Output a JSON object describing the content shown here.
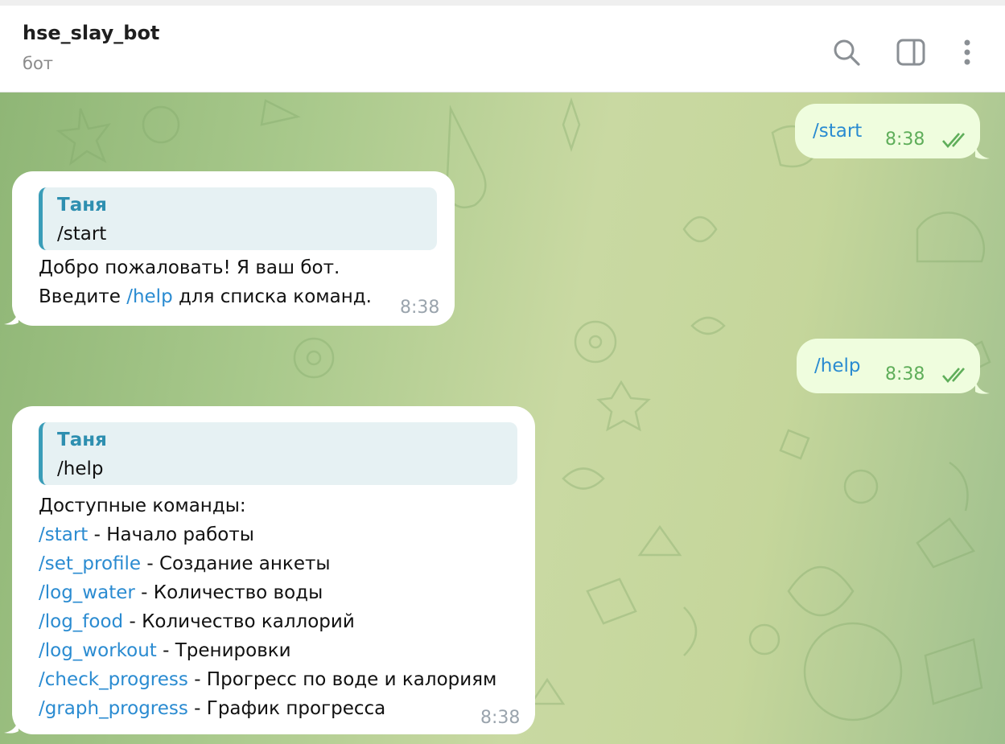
{
  "header": {
    "title": "hse_slay_bot",
    "subtitle": "бот",
    "icons": [
      "search-icon",
      "sidebar-toggle-icon",
      "more-vertical-icon"
    ]
  },
  "colors": {
    "outgoing_bubble": "#effdde",
    "incoming_bubble": "#ffffff",
    "command_link": "#2a8bd1",
    "quote_accent": "#3a9db8",
    "time_outgoing": "#5fae5a"
  },
  "messages": [
    {
      "type": "outgoing",
      "text": "/start",
      "time": "8:38",
      "status_icon": "double-check-icon"
    },
    {
      "type": "incoming",
      "reply_to": {
        "author": "Таня",
        "text": "/start"
      },
      "line1": "Добро пожаловать! Я ваш бот.",
      "line2_prefix": "Введите ",
      "line2_cmd": "/help",
      "line2_suffix": " для списка команд.",
      "time": "8:38"
    },
    {
      "type": "outgoing",
      "text": "/help",
      "time": "8:38",
      "status_icon": "double-check-icon"
    },
    {
      "type": "incoming",
      "reply_to": {
        "author": "Таня",
        "text": "/help"
      },
      "heading": "Доступные команды:",
      "commands": [
        {
          "cmd": "/start",
          "desc": " - Начало работы"
        },
        {
          "cmd": "/set_profile",
          "desc": " - Создание анкеты"
        },
        {
          "cmd": "/log_water",
          "desc": " - Количество воды"
        },
        {
          "cmd": "/log_food",
          "desc": " - Количество каллорий"
        },
        {
          "cmd": "/log_workout",
          "desc": " - Тренировки"
        },
        {
          "cmd": "/check_progress",
          "desc": " - Прогресс по воде и калориям"
        },
        {
          "cmd": "/graph_progress",
          "desc": " - График прогресса"
        }
      ],
      "time": "8:38"
    }
  ]
}
